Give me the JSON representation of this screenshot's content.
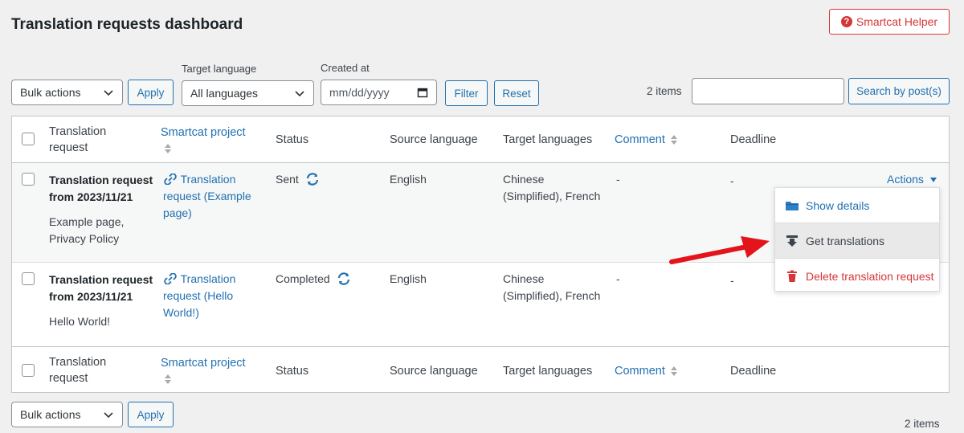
{
  "page": {
    "title": "Translation requests dashboard",
    "helper_button": "Smartcat Helper"
  },
  "filters": {
    "bulk_actions": "Bulk actions",
    "apply": "Apply",
    "target_language_label": "Target language",
    "target_language_value": "All languages",
    "created_at_label": "Created at",
    "date_placeholder": "mm/dd/yyyy",
    "filter": "Filter",
    "reset": "Reset",
    "items_count": "2 items",
    "search_button": "Search by post(s)"
  },
  "table": {
    "headers": {
      "request_line1": "Translation",
      "request_line2": "request",
      "project": "Smartcat project",
      "status": "Status",
      "source": "Source language",
      "targets": "Target languages",
      "comment": "Comment",
      "deadline": "Deadline"
    },
    "rows": [
      {
        "title_line1": "Translation request",
        "title_line2": "from 2023/11/21",
        "posts_line1": "Example page,",
        "posts_line2": "Privacy Policy",
        "project_line1": "Translation",
        "project_line2": "request (Example",
        "project_line3": "page)",
        "status": "Sent",
        "source": "English",
        "targets_line1": "Chinese",
        "targets_line2": "(Simplified), French",
        "comment": "-",
        "deadline": "-",
        "actions": "Actions"
      },
      {
        "title_line1": "Translation request",
        "title_line2": "from 2023/11/21",
        "posts_line1": "Hello World!",
        "project_line1": "Translation",
        "project_line2": "request (Hello",
        "project_line3": "World!)",
        "status": "Completed",
        "source": "English",
        "targets_line1": "Chinese",
        "targets_line2": "(Simplified), French",
        "comment": "-",
        "deadline": "-"
      }
    ]
  },
  "actions_menu": {
    "show_details": "Show details",
    "get_translations": "Get translations",
    "delete_request": "Delete translation request"
  },
  "footer": {
    "bulk_actions": "Bulk actions",
    "apply": "Apply",
    "items_count": "2 items"
  },
  "colors": {
    "accent": "#2271b1",
    "danger": "#d63638",
    "arrow": "#e3141b",
    "folder": "#2f7fc8"
  },
  "icons": [
    "question-icon",
    "chevron-down-icon",
    "calendar-icon",
    "sort-icon",
    "link-icon",
    "sync-icon",
    "caret-down-icon",
    "folder-icon",
    "download-icon",
    "trash-icon",
    "arrow-annotation"
  ]
}
